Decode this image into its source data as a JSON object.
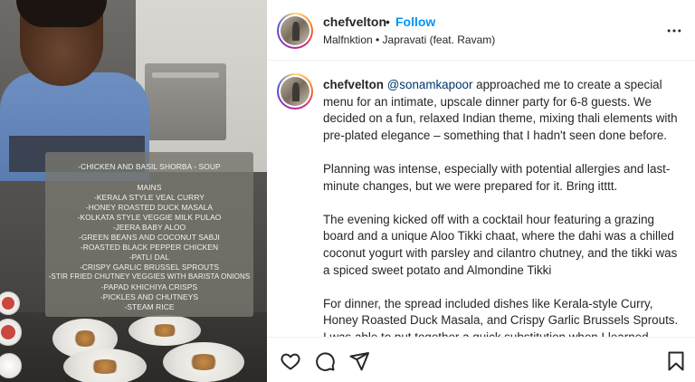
{
  "post": {
    "username": "chefvelton",
    "separator": "•",
    "follow_label": "Follow",
    "audio": "Malfnktion • Japravati (feat. Ravam)"
  },
  "media": {
    "menu_lines": [
      "-CHICKEN AND BASIL SHORBA - SOUP",
      "",
      "MAINS",
      "-KERALA STYLE VEAL CURRY",
      "-HONEY ROASTED DUCK MASALA",
      "-KOLKATA STYLE VEGGIE MILK PULAO",
      "-JEERA BABY ALOO",
      "-GREEN BEANS AND COCONUT SABJI",
      "-ROASTED BLACK PEPPER CHICKEN",
      "-PATLI DAL",
      "-CRISPY GARLIC BRUSSEL SPROUTS",
      "-STIR FRIED CHUTNEY VEGGIES WITH BARISTA ONIONS",
      "-PAPAD KHICHIYA CRISPS",
      "-PICKLES AND CHUTNEYS",
      "-STEAM RICE"
    ]
  },
  "caption": {
    "username": "chefvelton",
    "mention": "@sonamkapoor",
    "p1_rest": " approached me to create a special menu for an intimate, upscale dinner party for 6-8 guests. We decided on a fun, relaxed Indian theme, mixing thali elements with pre-plated elegance – something that I hadn't seen done before.",
    "p2": "Planning was intense, especially with potential allergies and last-minute changes, but we were prepared for it. Bring itttt.",
    "p3": "The evening kicked off with a cocktail hour featuring a grazing board and a unique Aloo Tikki chaat, where the dahi was a chilled coconut yogurt with parsley and cilantro chutney, and the tikki was a spiced sweet potato and Almondine Tikki",
    "p4": "For dinner, the spread included dishes like Kerala-style Curry, Honey Roasted Duck Masala, and Crispy Garlic Brussels Sprouts. I was able to put together a quick substitution when I learned"
  },
  "icons": {
    "more": "more-horizontal-icon",
    "like": "heart-icon",
    "comment": "comment-icon",
    "share": "send-icon",
    "save": "bookmark-icon"
  },
  "colors": {
    "follow": "#0095f6",
    "mention": "#00376b",
    "text": "#262626"
  }
}
